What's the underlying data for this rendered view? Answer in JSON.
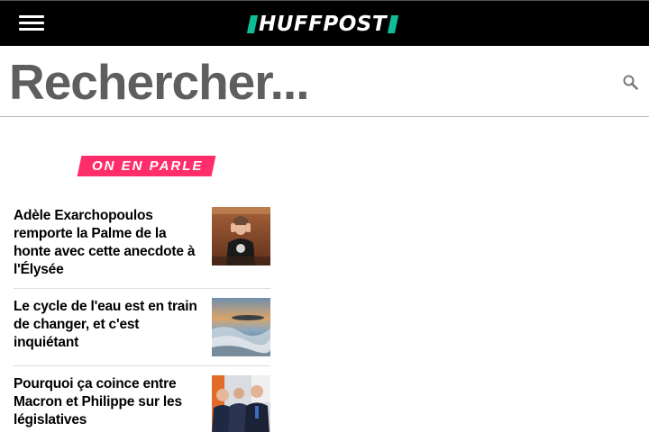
{
  "header": {
    "menu_icon": "hamburger-menu-icon",
    "logo_text": "HUFFPOST",
    "logo_accent_color": "#0dbe98",
    "background_color": "#000000"
  },
  "search": {
    "placeholder": "Rechercher...",
    "value": "",
    "icon": "search-icon"
  },
  "trending": {
    "label": "ON EN PARLE",
    "label_color": "#ff2e6b",
    "articles": [
      {
        "headline": "Adèle Exarchopoulos remporte la Palme de la honte avec cette anecdote à l'Élysée",
        "thumbnail": "woman-covering-ears-photo"
      },
      {
        "headline": "Le cycle de l'eau est en train de changer, et c'est inquiétant",
        "thumbnail": "ocean-waves-sunset-photo"
      },
      {
        "headline": "Pourquoi ça coince entre Macron et Philippe sur les législatives",
        "thumbnail": "politicians-in-suits-photo"
      }
    ]
  }
}
